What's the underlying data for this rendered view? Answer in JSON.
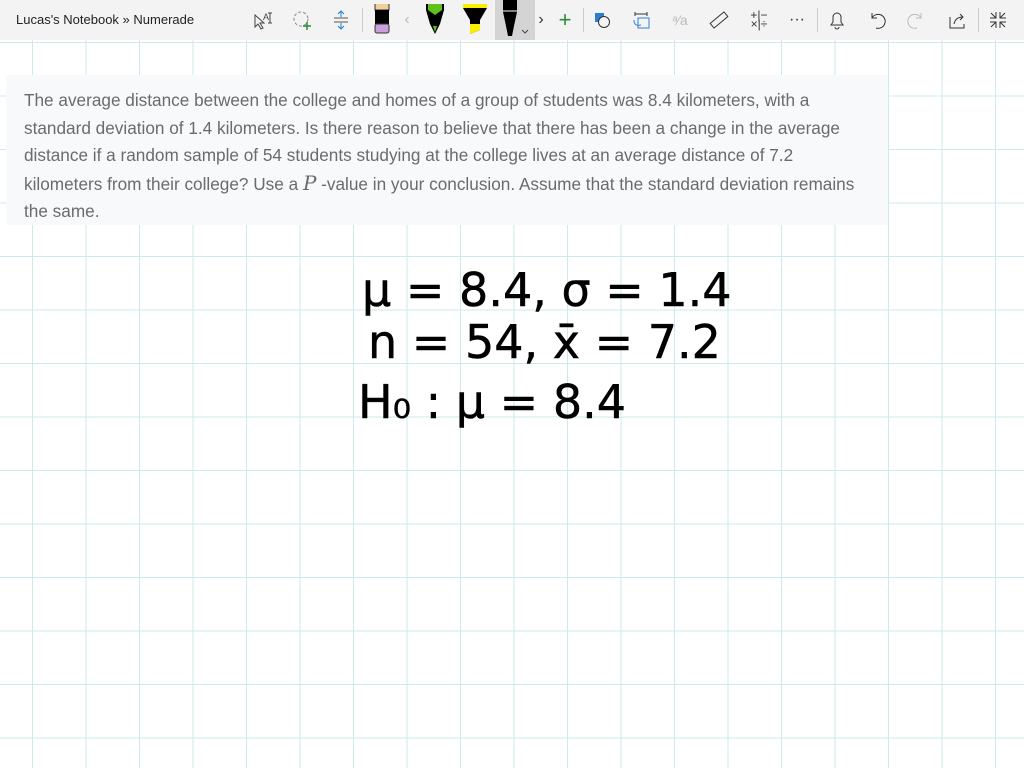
{
  "window": {
    "title": "Lucas's Notebook » Numerade"
  },
  "toolbar": {
    "items": [
      "lasso-select",
      "add-space",
      "insert-space",
      "eraser-pen",
      "scroll-left",
      "green-pen",
      "yellow-highlighter",
      "black-pen",
      "scroll-right",
      "add-pen",
      "shapes",
      "ink-to-shape",
      "ink-to-text",
      "ruler",
      "math",
      "more",
      "notifications",
      "undo",
      "redo",
      "share",
      "exit-fullscreen"
    ]
  },
  "question": {
    "before": "The average distance between the college and homes of a group of students was 8.4 kilometers, with a standard deviation of 1.4 kilometers. Is there reason to believe that there has been a change in the average distance if a random sample of 54 students studying at the college lives at an average distance of 7.2 kilometers from their college? Use a ",
    "var": "P",
    "after": " -value in your conclusion. Assume that the standard deviation remains the same."
  },
  "handwriting": {
    "line1": "μ = 8.4,  σ = 1.4",
    "line2": "n = 54,   x̄ = 7.2",
    "line3": "H₀ :   μ = 8.4"
  }
}
